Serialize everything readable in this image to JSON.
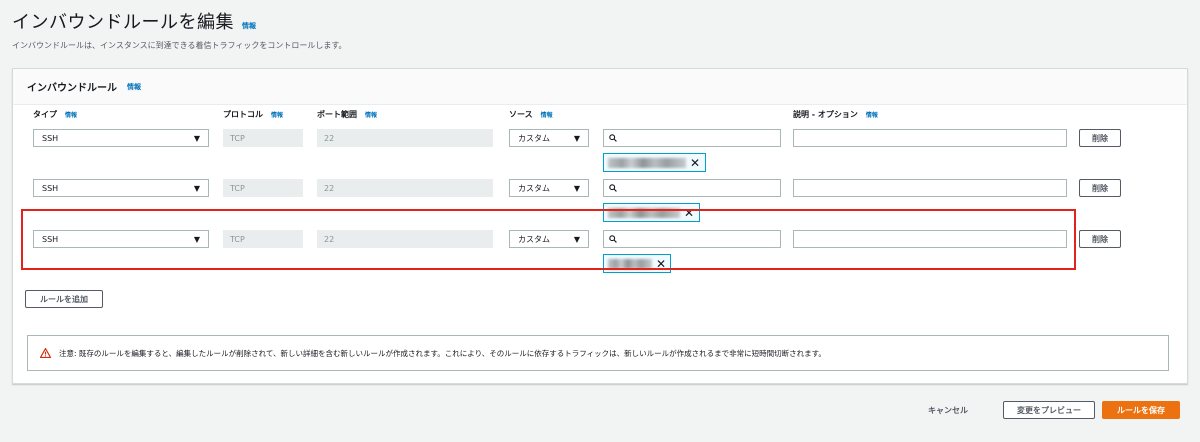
{
  "page": {
    "title": "インバウンドルールを編集",
    "info": "情報",
    "description": "インバウンドルールは、インスタンスに到達できる着信トラフィックをコントロールします。"
  },
  "panel": {
    "title": "インバウンドルール",
    "info": "情報",
    "columns": {
      "type": "タイプ",
      "protocol": "プロトコル",
      "port_range": "ポート範囲",
      "source": "ソース",
      "description": "説明 - オプション",
      "info": "情報"
    },
    "rules": [
      {
        "type": "SSH",
        "protocol": "TCP",
        "port_range": "22",
        "source": "カスタム",
        "search_value": "",
        "description_value": "",
        "delete_label": "削除"
      },
      {
        "type": "SSH",
        "protocol": "TCP",
        "port_range": "22",
        "source": "カスタム",
        "search_value": "",
        "description_value": "",
        "delete_label": "削除"
      },
      {
        "type": "SSH",
        "protocol": "TCP",
        "port_range": "22",
        "source": "カスタム",
        "search_value": "",
        "description_value": "",
        "delete_label": "削除"
      }
    ],
    "add_rule_label": "ルールを追加",
    "warning": "注意: 既存のルールを編集すると、編集したルールが削除されて、新しい詳細を含む新しいルールが作成されます。これにより、そのルールに依存するトラフィックは、新しいルールが作成されるまで非常に短時間切断されます。"
  },
  "footer": {
    "cancel_label": "キャンセル",
    "preview_label": "変更をプレビュー",
    "save_label": "ルールを保存"
  },
  "colors": {
    "accent_orange": "#ec7211",
    "link_blue": "#0073bb",
    "token_border": "#00a1c9",
    "highlight_red": "#e2231a",
    "warning_red": "#d13212"
  },
  "icons": [
    "search-icon",
    "close-icon",
    "chevron-down-icon",
    "warning-icon"
  ]
}
